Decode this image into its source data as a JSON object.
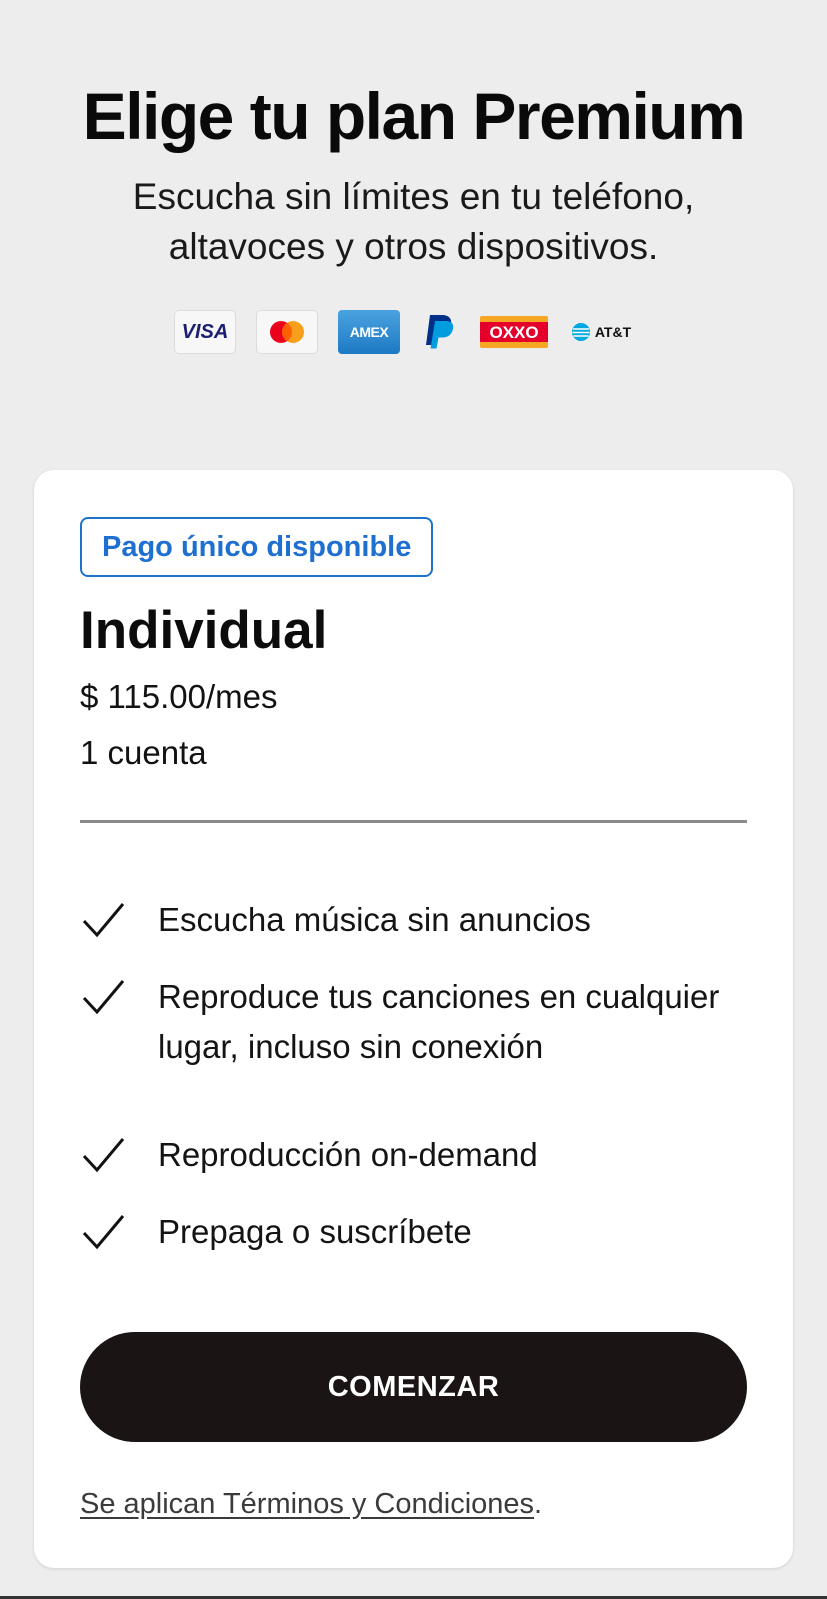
{
  "header": {
    "title": "Elige tu plan Premium",
    "subtitle_line1": "Escucha sin límites en tu teléfono,",
    "subtitle_line2": "altavoces y otros dispositivos."
  },
  "payment_methods": {
    "visa": "VISA",
    "mastercard": "mastercard",
    "amex": "AMEX",
    "paypal": "paypal",
    "oxxo": "OXXO",
    "att": "AT&T"
  },
  "plan": {
    "badge": "Pago único disponible",
    "name": "Individual",
    "price": "$ 115.00/mes",
    "accounts": "1 cuenta",
    "features": [
      "Escucha música sin anuncios",
      "Reproduce tus canciones en cualquier lugar, incluso sin conexión",
      "Reproducción on-demand",
      "Prepaga o suscríbete"
    ],
    "cta_label": "COMENZAR",
    "terms_link": "Se aplican Términos y Condiciones",
    "terms_suffix": "."
  },
  "colors": {
    "background": "#ededed",
    "card": "#ffffff",
    "badge_blue": "#1e6fd0",
    "cta_background": "#1b1414",
    "cta_text": "#ffffff"
  },
  "icons": {
    "feature_bullet": "check-icon"
  }
}
